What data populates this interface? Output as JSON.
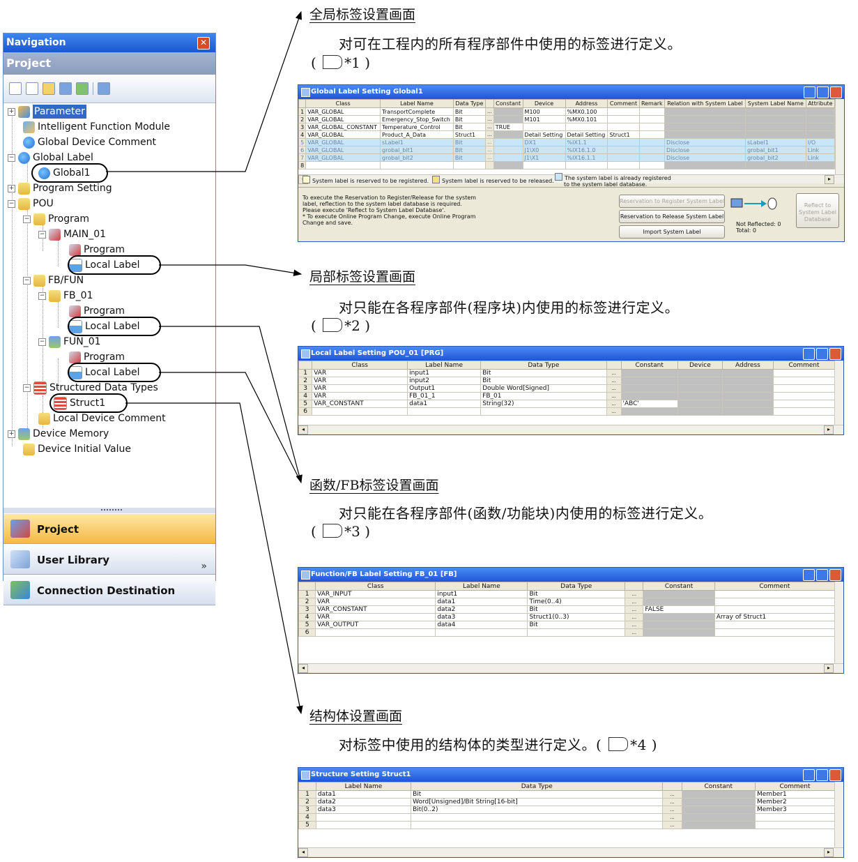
{
  "nav": {
    "title": "Navigation",
    "section": "Project",
    "tree": [
      {
        "label": "Parameter"
      },
      {
        "label": "Intelligent Function Module"
      },
      {
        "label": "Global Device Comment"
      },
      {
        "label": "Global Label"
      },
      {
        "label": "Global1"
      },
      {
        "label": "Program Setting"
      },
      {
        "label": "POU"
      },
      {
        "label": "Program"
      },
      {
        "label": "MAIN_01"
      },
      {
        "label": "Program"
      },
      {
        "label": "Local Label"
      },
      {
        "label": "FB/FUN"
      },
      {
        "label": "FB_01"
      },
      {
        "label": "Program"
      },
      {
        "label": "Local Label"
      },
      {
        "label": "FUN_01"
      },
      {
        "label": "Program"
      },
      {
        "label": "Local Label"
      },
      {
        "label": "Structured Data Types"
      },
      {
        "label": "Struct1"
      },
      {
        "label": "Local Device Comment"
      },
      {
        "label": "Device Memory"
      },
      {
        "label": "Device Initial Value"
      }
    ],
    "buttons": [
      "Project",
      "User Library",
      "Connection Destination"
    ],
    "more": "»"
  },
  "sections": [
    {
      "heading": "全局标签设置画面",
      "desc": "对可在工程内的所有程序部件中使用的标签进行定义。",
      "ref": "*1"
    },
    {
      "heading": "局部标签设置画面",
      "desc": "对只能在各程序部件(程序块)内使用的标签进行定义。",
      "ref": "*2"
    },
    {
      "heading": "函数/FB标签设置画面",
      "desc": "对只能在各程序部件(函数/功能块)内使用的标签进行定义。",
      "ref": "*3"
    },
    {
      "heading": "结构体设置画面",
      "desc": "对标签中使用的结构体的类型进行定义。(",
      "ref": "*4"
    }
  ],
  "global_window": {
    "title": "Global Label Setting Global1",
    "headers": [
      "",
      "Class",
      "Label Name",
      "Data Type",
      "",
      "Constant",
      "Device",
      "Address",
      "Comment",
      "Remark",
      "Relation with System Label",
      "System Label Name",
      "Attribute"
    ],
    "rows": [
      [
        "1",
        "VAR_GLOBAL",
        "TransportComplete",
        "Bit",
        "...",
        "",
        "M100",
        "%MX0.100",
        "",
        "",
        "",
        "",
        ""
      ],
      [
        "2",
        "VAR_GLOBAL",
        "Emergency_Stop_Switch",
        "Bit",
        "...",
        "",
        "M101",
        "%MX0.101",
        "",
        "",
        "",
        "",
        ""
      ],
      [
        "3",
        "VAR_GLOBAL_CONSTANT",
        "Temperature_Control",
        "Bit",
        "...",
        "TRUE",
        "",
        "",
        "",
        "",
        "",
        "",
        ""
      ],
      [
        "4",
        "VAR_GLOBAL",
        "Product_A_Data",
        "Struct1",
        "...",
        "",
        "Detail Setting",
        "Detail Setting",
        "Struct1",
        "",
        "",
        "",
        ""
      ],
      [
        "5",
        "VAR_GLOBAL",
        "sLabel1",
        "Bit",
        "...",
        "",
        "DX1",
        "%IX1.1",
        "",
        "",
        "Disclose",
        "sLabel1",
        "I/O"
      ],
      [
        "6",
        "VAR_GLOBAL",
        "grobal_bit1",
        "Bit",
        "...",
        "",
        "J1\\X0",
        "%IX16.1.0",
        "",
        "",
        "Disclose",
        "grobal_bit1",
        "Link"
      ],
      [
        "7",
        "VAR_GLOBAL",
        "grobal_bit2",
        "Bit",
        "...",
        "",
        "J1\\X1",
        "%IX16.1.1",
        "",
        "",
        "Disclose",
        "grobal_bit2",
        "Link"
      ],
      [
        "8",
        "",
        "",
        "",
        "",
        "",
        "",
        "",
        "",
        "",
        "",
        "",
        ""
      ]
    ],
    "legend": [
      "System label is reserved to be registered.",
      "System label is reserved to be released.",
      "The system label is already registered",
      "to the system label database."
    ],
    "note": [
      "To execute the Reservation to Register/Release for the system",
      "label, reflection to the system label database is required.",
      "Please execute 'Reflect to System Label Database'.",
      "* To execute Online Program Change, execute Online Program",
      "Change and save."
    ],
    "btn_register": "Reservation to Register System Label",
    "btn_release": "Reservation to Release System Label",
    "btn_import": "Import System Label",
    "btn_reflect": [
      "Reflect to",
      "System Label",
      "Database"
    ],
    "not_reflected": "Not Reflected: 0",
    "total": "Total: 0"
  },
  "local_window": {
    "title": "Local Label Setting POU_01 [PRG]",
    "headers": [
      "",
      "Class",
      "Label Name",
      "Data Type",
      "",
      "Constant",
      "Device",
      "Address",
      "Comment"
    ],
    "rows": [
      [
        "1",
        "VAR",
        "input1",
        "Bit",
        "...",
        "",
        "",
        "",
        ""
      ],
      [
        "2",
        "VAR",
        "input2",
        "Bit",
        "...",
        "",
        "",
        "",
        ""
      ],
      [
        "3",
        "VAR",
        "Output1",
        "Double Word[Signed]",
        "...",
        "",
        "",
        "",
        ""
      ],
      [
        "4",
        "VAR",
        "FB_01_1",
        "FB_01",
        "...",
        "",
        "",
        "",
        ""
      ],
      [
        "5",
        "VAR_CONSTANT",
        "data1",
        "String(32)",
        "...",
        "'ABC'",
        "",
        "",
        ""
      ],
      [
        "6",
        "",
        "",
        "",
        "...",
        "",
        "",
        "",
        ""
      ]
    ]
  },
  "fb_window": {
    "title": "Function/FB Label Setting FB_01 [FB]",
    "headers": [
      "",
      "Class",
      "Label Name",
      "Data Type",
      "",
      "Constant",
      "Comment"
    ],
    "rows": [
      [
        "1",
        "VAR_INPUT",
        "input1",
        "Bit",
        "...",
        "",
        ""
      ],
      [
        "2",
        "VAR",
        "data1",
        "Time(0..4)",
        "...",
        "",
        ""
      ],
      [
        "3",
        "VAR_CONSTANT",
        "data2",
        "Bit",
        "...",
        "FALSE",
        ""
      ],
      [
        "4",
        "VAR",
        "data3",
        "Struct1(0..3)",
        "...",
        "",
        "Array of Struct1"
      ],
      [
        "5",
        "VAR_OUTPUT",
        "data4",
        "Bit",
        "...",
        "",
        ""
      ],
      [
        "6",
        "",
        "",
        "",
        "...",
        "",
        ""
      ]
    ]
  },
  "struct_window": {
    "title": "Structure Setting Struct1",
    "headers": [
      "",
      "Label Name",
      "Data Type",
      "",
      "Constant",
      "Comment"
    ],
    "rows": [
      [
        "1",
        "data1",
        "Bit",
        "...",
        "",
        "Member1"
      ],
      [
        "2",
        "data2",
        "Word[Unsigned]/Bit String[16-bit]",
        "...",
        "",
        "Member2"
      ],
      [
        "3",
        "data3",
        "Bit(0..2)",
        "...",
        "",
        "Member3"
      ],
      [
        "4",
        "",
        "",
        "...",
        "",
        ""
      ],
      [
        "5",
        "",
        "",
        "...",
        "",
        ""
      ]
    ]
  }
}
